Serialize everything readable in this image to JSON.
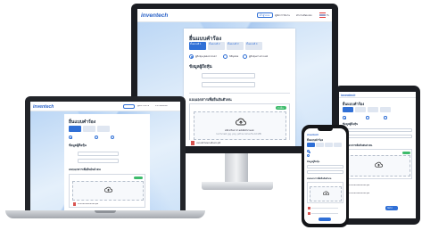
{
  "brand": {
    "logo_text": "inventech"
  },
  "nav": {
    "login_label": "เข้าสู่ระบบ",
    "manual_label": "คู่มือการใช้งาน",
    "faq_label": "คำถามที่พบบ่อย",
    "lang_label": "TH"
  },
  "form": {
    "title": "ยื่นแบบคำร้อง",
    "steps": [
      {
        "label": "ขั้นตอนที่ 1",
        "sub": "ข้อมูลผู้ถือหุ้น"
      },
      {
        "label": "ขั้นตอนที่ 2",
        "sub": "ข้อมูลเอกสาร"
      },
      {
        "label": "ขั้นตอนที่ 3",
        "sub": "ยืนยันข้อมูล"
      },
      {
        "label": "ขั้นตอนที่ 4",
        "sub": "เสร็จสิ้น"
      }
    ],
    "options": [
      "ผู้ถือหุ้นบุคคลธรรมดา",
      "นิติบุคคล",
      "ผู้ถือหุ้นต่างประเทศ"
    ],
    "section_identity": "ข้อมูลผู้ถือหุ้น",
    "section_upload": "แนบเอกสารเพื่อยืนยันตัวตน",
    "upload_hint": "คลิกหรือลากไฟล์เพื่ออัปโหลด",
    "upload_required_badge": "จำเป็น",
    "upload_filetypes": "รองรับไฟล์ .jpg .png .pdf ขนาดไม่เกิน 10 MB",
    "file_name": "แบบฟอร์มมอบฉันทะ.pdf",
    "next_label": "ถัดไป"
  },
  "colors": {
    "accent": "#2f6fd6",
    "success": "#3dbb6b",
    "frame": "#1b1d22"
  },
  "icons": [
    "cloud-upload-icon",
    "file-pdf-icon",
    "user-icon",
    "apple-logo-icon"
  ]
}
